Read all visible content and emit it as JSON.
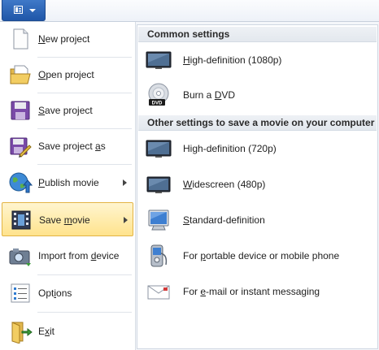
{
  "app_menu": {
    "button_icon": "app-menu-icon"
  },
  "left_menu": {
    "items": [
      {
        "pre": "",
        "u": "N",
        "post": "ew project",
        "icon": "new-project-icon"
      },
      {
        "pre": "",
        "u": "O",
        "post": "pen project",
        "icon": "open-project-icon"
      },
      {
        "pre": "",
        "u": "S",
        "post": "ave project",
        "icon": "save-project-icon"
      },
      {
        "pre": "Save project ",
        "u": "a",
        "post": "s",
        "icon": "save-project-as-icon"
      },
      {
        "pre": "",
        "u": "P",
        "post": "ublish movie",
        "icon": "publish-movie-icon",
        "submenu": true
      },
      {
        "pre": "Save ",
        "u": "m",
        "post": "ovie",
        "icon": "save-movie-icon",
        "submenu": true,
        "highlighted": true
      },
      {
        "pre": "Import from ",
        "u": "d",
        "post": "evice",
        "icon": "import-device-icon"
      },
      {
        "pre": "Opt",
        "u": "i",
        "post": "ons",
        "icon": "options-icon"
      },
      {
        "pre": "E",
        "u": "x",
        "post": "it",
        "icon": "exit-icon"
      }
    ]
  },
  "submenu": {
    "section1_title": "Common settings",
    "section2_title": "Other settings to save a movie on your computer",
    "items": [
      {
        "pre": "",
        "u": "H",
        "post": "igh-definition (1080p)",
        "icon": "hd-monitor-icon"
      },
      {
        "pre": "Burn a ",
        "u": "D",
        "post": "VD",
        "icon": "dvd-icon"
      },
      {
        "pre": "Hi",
        "u": "g",
        "post": "h-definition (720p)",
        "icon": "hd-monitor-icon"
      },
      {
        "pre": "",
        "u": "W",
        "post": "idescreen (480p)",
        "icon": "widescreen-monitor-icon"
      },
      {
        "pre": "",
        "u": "S",
        "post": "tandard-definition",
        "icon": "standard-monitor-icon"
      },
      {
        "pre": "For ",
        "u": "p",
        "post": "ortable device or mobile phone",
        "icon": "mobile-phone-icon"
      },
      {
        "pre": "For ",
        "u": "e",
        "post": "-mail or instant messaging",
        "icon": "email-icon"
      }
    ]
  }
}
